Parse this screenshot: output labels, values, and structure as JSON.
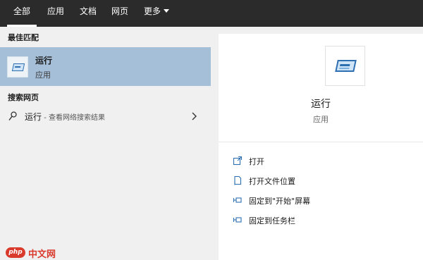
{
  "tabs": [
    {
      "label": "全部",
      "active": true
    },
    {
      "label": "应用"
    },
    {
      "label": "文档"
    },
    {
      "label": "网页"
    },
    {
      "label": "更多"
    }
  ],
  "best_match": {
    "heading": "最佳匹配",
    "title": "运行",
    "subtitle": "应用",
    "icon": "run-dialog-icon"
  },
  "web_search": {
    "heading": "搜索网页",
    "query": "运行",
    "hint": " - 查看网络搜索结果"
  },
  "detail": {
    "title": "运行",
    "subtitle": "应用",
    "icon": "run-dialog-icon"
  },
  "actions": [
    {
      "label": "打开",
      "icon": "open-icon"
    },
    {
      "label": "打开文件位置",
      "icon": "file-location-icon"
    },
    {
      "label": "固定到\"开始\"屏幕",
      "icon": "pin-icon"
    },
    {
      "label": "固定到任务栏",
      "icon": "pin-icon"
    }
  ],
  "watermark": {
    "badge": "php",
    "text": "中文网"
  },
  "colors": {
    "topbar": "#2b2b2b",
    "selected_row": "#a6bfd8",
    "accent": "#2d6fb0",
    "watermark": "#d93a2c"
  }
}
